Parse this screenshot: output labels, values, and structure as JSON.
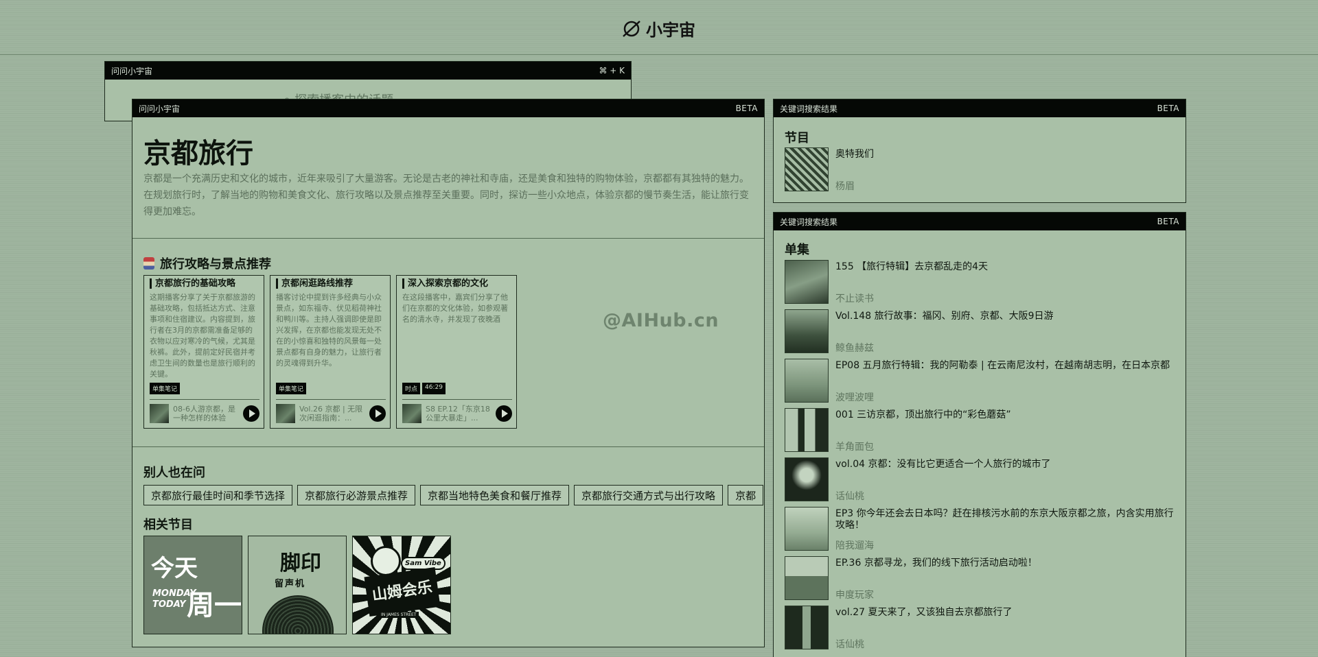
{
  "app": {
    "logo_text": "小宇宙"
  },
  "back_panel": {
    "title": "问问小宇宙",
    "shortcut": "⌘ + K",
    "search_placeholder": "探索播客中的话题"
  },
  "main_panel": {
    "title_bar": "问问小宇宙",
    "badge": "BETA",
    "heading": "京都旅行",
    "description": "京都是一个充满历史和文化的城市，近年来吸引了大量游客。无论是古老的神社和寺庙，还是美食和独特的购物体验，京都都有其独特的魅力。在规划旅行时，了解当地的购物和美食文化、旅行攻略以及景点推荐至关重要。同时，探访一些小众地点，体验京都的慢节奏生活，能让旅行变得更加难忘。",
    "guide_section": "旅行攻略与景点推荐",
    "cards": [
      {
        "title": "京都旅行的基础攻略",
        "body": "这期播客分享了关于京都旅游的基础攻略，包括抵达方式、注意事项和住宿建议。内容提到，旅行者在3月的京都需准备足够的衣物以应对寒冷的气候，尤其是秋裤。此外，提前定好民宿并考虑卫生间的数量也是旅行顺利的关键。",
        "tags": [
          "单集笔记"
        ],
        "episode": "08-6人游京都，是一种怎样的体验"
      },
      {
        "title": "京都闲逛路线推荐",
        "body": "播客讨论中提到许多经典与小众景点，如东福寺、伏见稻荷神社和鸭川等。主持人强调即使是即兴发挥，在京都也能发现无处不在的小惊喜和独特的风景每一处景点都有自身的魅力，让旅行者的灵魂得到升华。",
        "tags": [
          "单集笔记"
        ],
        "episode": "Vol.26 京都 | 无限次闲逛指南：..."
      },
      {
        "title": "深入探索京都的文化",
        "body": "在这段播客中，嘉宾们分享了他们在京都的文化体验，如参观著名的清水寺，并发现了夜晚酒",
        "tags": [
          "时点",
          "46:29"
        ],
        "episode": "S8 EP.12「东京18公里大暴走」..."
      }
    ],
    "ask_section": "别人也在问",
    "questions": [
      "京都旅行最佳时间和季节选择",
      "京都旅行必游景点推荐",
      "京都当地特色美食和餐厅推荐",
      "京都旅行交通方式与出行攻略",
      "京都"
    ],
    "related_section": "相关节目",
    "covers": [
      {
        "big": "今天",
        "small1": "MONDAY",
        "small2": "TODAY",
        "big2": "周一"
      },
      {
        "t1": "脚印",
        "t2": "留声机"
      },
      {
        "main": "山姆会乐",
        "sub": "Sam Vibe",
        "street": "IN JAMES STREET"
      }
    ]
  },
  "kw_panel_1": {
    "title_bar": "关键词搜索结果",
    "badge": "BETA",
    "heading": "节目",
    "items": [
      {
        "title": "奥特我们",
        "author": "杨眉"
      }
    ]
  },
  "kw_panel_2": {
    "title_bar": "关键词搜索结果",
    "badge": "BETA",
    "heading": "单集",
    "items": [
      {
        "title": "155 【旅行特辑】去京都乱走的4天",
        "author": "不止读书"
      },
      {
        "title": "Vol.148 旅行故事：福冈、别府、京都、大阪9日游",
        "author": "鲸鱼赫兹"
      },
      {
        "title": "EP08 五月旅行特辑：我的阿勒泰 | 在云南尼汝村，在越南胡志明，在日本京都",
        "author": "波哩波哩"
      },
      {
        "title": "001 三访京都，顶出旅行中的“彩色蘑菇”",
        "author": "羊角面包"
      },
      {
        "title": "vol.04 京都：没有比它更适合一个人旅行的城市了",
        "author": "话仙桃"
      },
      {
        "title": "EP3 你今年还会去日本吗？赶在排核污水前的东京大阪京都之旅，内含实用旅行攻略！",
        "author": "陪我遛海"
      },
      {
        "title": "EP.36 京都寻龙，我们的线下旅行活动启动啦！",
        "author": "申度玩家"
      },
      {
        "title": "vol.27 夏天来了，又该独自去京都旅行了",
        "author": "话仙桃"
      }
    ]
  },
  "watermark": "@AIHub.cn"
}
